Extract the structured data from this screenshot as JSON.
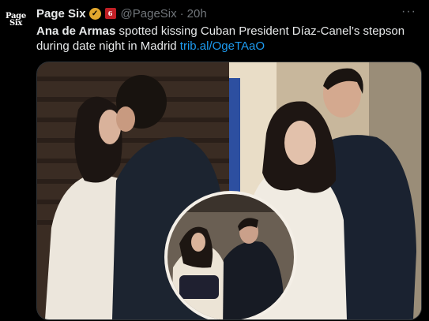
{
  "tweet": {
    "avatar_line1": "Page",
    "avatar_line2": "Six",
    "author_name": "Page Six",
    "affiliate_badge": "6",
    "handle": "@PageSix",
    "separator": "·",
    "time": "20h",
    "more": "···",
    "text_bold": "Ana de Armas",
    "text_body": " spotted kissing Cuban President Díaz-Canel’s stepson during date night in Madrid ",
    "link": "trib.al/OgeTAaO"
  },
  "media": {
    "description": "photo-collage",
    "icons": {
      "verified": "verified-gold-badge",
      "more": "more-icon"
    }
  }
}
